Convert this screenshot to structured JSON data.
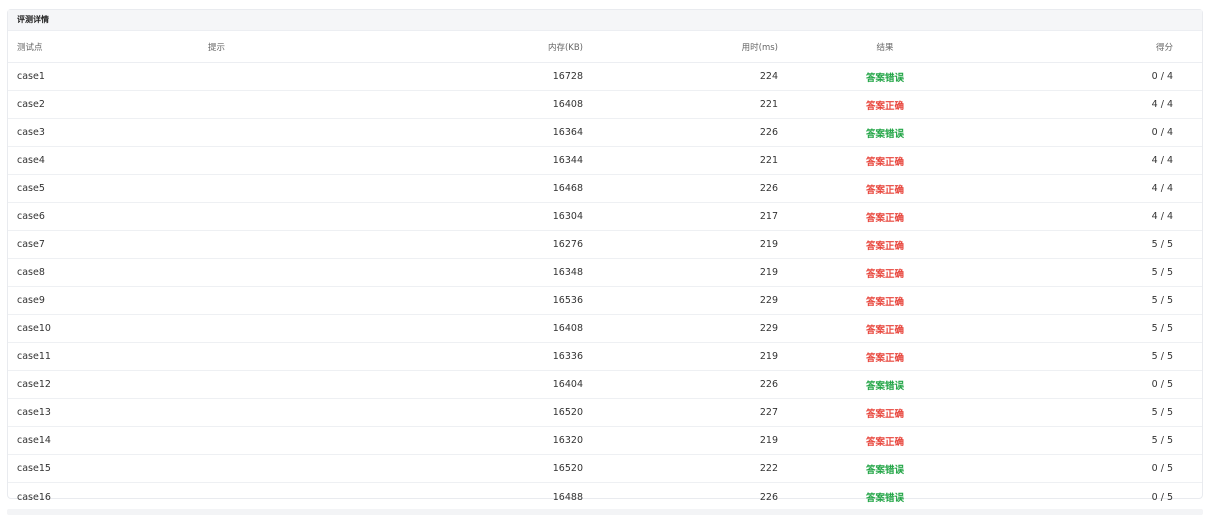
{
  "panel": {
    "title": "评测详情"
  },
  "table": {
    "columns": {
      "name": "测试点",
      "hint": "提示",
      "memory": "内存(KB)",
      "time": "用时(ms)",
      "result": "结果",
      "score": "得分"
    },
    "status_colors": {
      "答案错误": "#22a546",
      "答案正确": "#e8453c"
    },
    "rows": [
      {
        "name": "case1",
        "hint": "",
        "memory": "16728",
        "time": "224",
        "result": "答案错误",
        "score": "0 / 4"
      },
      {
        "name": "case2",
        "hint": "",
        "memory": "16408",
        "time": "221",
        "result": "答案正确",
        "score": "4 / 4"
      },
      {
        "name": "case3",
        "hint": "",
        "memory": "16364",
        "time": "226",
        "result": "答案错误",
        "score": "0 / 4"
      },
      {
        "name": "case4",
        "hint": "",
        "memory": "16344",
        "time": "221",
        "result": "答案正确",
        "score": "4 / 4"
      },
      {
        "name": "case5",
        "hint": "",
        "memory": "16468",
        "time": "226",
        "result": "答案正确",
        "score": "4 / 4"
      },
      {
        "name": "case6",
        "hint": "",
        "memory": "16304",
        "time": "217",
        "result": "答案正确",
        "score": "4 / 4"
      },
      {
        "name": "case7",
        "hint": "",
        "memory": "16276",
        "time": "219",
        "result": "答案正确",
        "score": "5 / 5"
      },
      {
        "name": "case8",
        "hint": "",
        "memory": "16348",
        "time": "219",
        "result": "答案正确",
        "score": "5 / 5"
      },
      {
        "name": "case9",
        "hint": "",
        "memory": "16536",
        "time": "229",
        "result": "答案正确",
        "score": "5 / 5"
      },
      {
        "name": "case10",
        "hint": "",
        "memory": "16408",
        "time": "229",
        "result": "答案正确",
        "score": "5 / 5"
      },
      {
        "name": "case11",
        "hint": "",
        "memory": "16336",
        "time": "219",
        "result": "答案正确",
        "score": "5 / 5"
      },
      {
        "name": "case12",
        "hint": "",
        "memory": "16404",
        "time": "226",
        "result": "答案错误",
        "score": "0 / 5"
      },
      {
        "name": "case13",
        "hint": "",
        "memory": "16520",
        "time": "227",
        "result": "答案正确",
        "score": "5 / 5"
      },
      {
        "name": "case14",
        "hint": "",
        "memory": "16320",
        "time": "219",
        "result": "答案正确",
        "score": "5 / 5"
      },
      {
        "name": "case15",
        "hint": "",
        "memory": "16520",
        "time": "222",
        "result": "答案错误",
        "score": "0 / 5"
      },
      {
        "name": "case16",
        "hint": "",
        "memory": "16488",
        "time": "226",
        "result": "答案错误",
        "score": "0 / 5"
      }
    ]
  }
}
